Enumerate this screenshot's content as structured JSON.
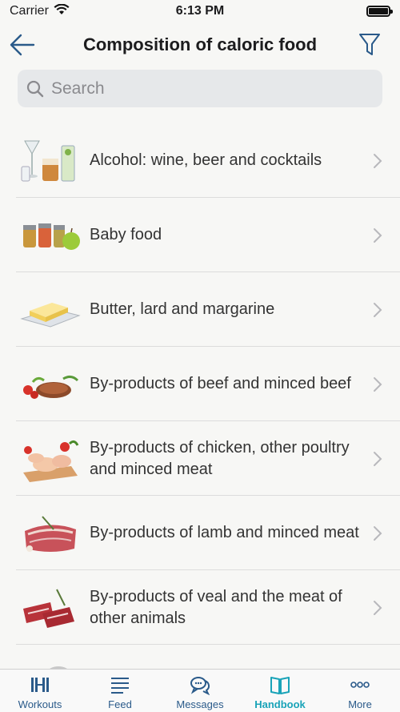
{
  "status": {
    "carrier": "Carrier",
    "time": "6:13 PM"
  },
  "header": {
    "title": "Composition of caloric food"
  },
  "search": {
    "placeholder": "Search"
  },
  "categories": [
    {
      "label": "Alcohol: wine, beer and cocktails",
      "icon": "alcohol-image"
    },
    {
      "label": "Baby food",
      "icon": "baby-food-image"
    },
    {
      "label": "Butter, lard and margarine",
      "icon": "butter-image"
    },
    {
      "label": "By-products of beef and minced beef",
      "icon": "beef-image"
    },
    {
      "label": "By-products of chicken, other poultry and minced meat",
      "icon": "chicken-image"
    },
    {
      "label": "By-products of lamb and minced meat",
      "icon": "lamb-image"
    },
    {
      "label": "By-products of veal and the meat of other animals",
      "icon": "veal-image"
    }
  ],
  "tabs": [
    {
      "label": "Workouts",
      "icon": "dumbbell-icon"
    },
    {
      "label": "Feed",
      "icon": "feed-icon"
    },
    {
      "label": "Messages",
      "icon": "messages-icon"
    },
    {
      "label": "Handbook",
      "icon": "book-icon",
      "active": true
    },
    {
      "label": "More",
      "icon": "more-icon"
    }
  ],
  "colors": {
    "accent_active": "#19a3b8",
    "tab_inactive": "#2a5a8a",
    "nav_icon": "#2a5a8a"
  }
}
